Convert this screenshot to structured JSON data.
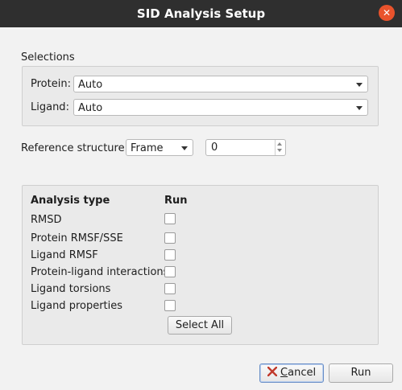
{
  "window": {
    "title": "SID Analysis Setup",
    "close_glyph": "✕"
  },
  "selections": {
    "title": "Selections",
    "protein_label": "Protein:",
    "protein_value": "Auto",
    "ligand_label": "Ligand:",
    "ligand_value": "Auto"
  },
  "reference": {
    "label": "Reference structure:",
    "mode_value": "Frame",
    "frame_value": "0"
  },
  "analysis": {
    "header_type": "Analysis type",
    "header_run": "Run",
    "items": [
      {
        "label": "RMSD",
        "checked": false
      },
      {
        "label": "Protein RMSF/SSE",
        "checked": false
      },
      {
        "label": "Ligand RMSF",
        "checked": false
      },
      {
        "label": "Protein-ligand interactions",
        "checked": false
      },
      {
        "label": "Ligand torsions",
        "checked": false
      },
      {
        "label": "Ligand properties",
        "checked": false
      }
    ],
    "select_all_label": "Select All"
  },
  "footer": {
    "cancel_label": "Cancel",
    "cancel_mnemonic": "C",
    "cancel_rest": "ancel",
    "run_label": "Run"
  },
  "colors": {
    "titlebar": "#2f2f2f",
    "close": "#e9532c",
    "cancel_icon": "#c0392b"
  }
}
